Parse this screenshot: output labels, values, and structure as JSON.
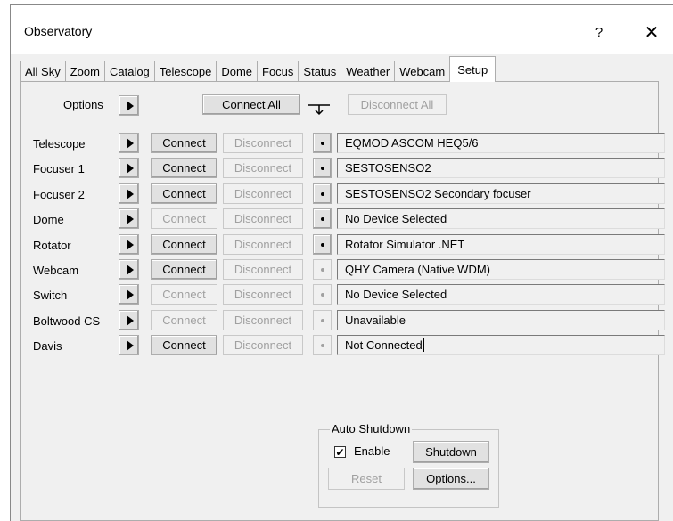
{
  "window": {
    "title": "Observatory",
    "help": "?",
    "close": "✕"
  },
  "tabs": [
    "All Sky",
    "Zoom",
    "Catalog",
    "Telescope",
    "Dome",
    "Focus",
    "Status",
    "Weather",
    "Webcam",
    "Setup"
  ],
  "active_tab": "Setup",
  "options_label": "Options",
  "connect_all": "Connect All",
  "disconnect_all": "Disconnect All",
  "connect_label": "Connect",
  "disconnect_label": "Disconnect",
  "devices": [
    {
      "label": "Telescope",
      "connect_enabled": true,
      "dot_enabled": true,
      "value": "EQMOD ASCOM HEQ5/6"
    },
    {
      "label": "Focuser 1",
      "connect_enabled": true,
      "dot_enabled": true,
      "value": "SESTOSENSO2"
    },
    {
      "label": "Focuser 2",
      "connect_enabled": true,
      "dot_enabled": true,
      "value": "SESTOSENSO2 Secondary focuser"
    },
    {
      "label": "Dome",
      "connect_enabled": false,
      "dot_enabled": true,
      "value": "No Device Selected"
    },
    {
      "label": "Rotator",
      "connect_enabled": true,
      "dot_enabled": true,
      "value": "Rotator Simulator .NET"
    },
    {
      "label": "Webcam",
      "connect_enabled": true,
      "dot_enabled": false,
      "value": "QHY Camera (Native WDM)"
    },
    {
      "label": "Switch",
      "connect_enabled": false,
      "dot_enabled": false,
      "value": "No Device Selected"
    },
    {
      "label": "Boltwood CS",
      "connect_enabled": false,
      "dot_enabled": false,
      "value": "Unavailable"
    },
    {
      "label": "Davis",
      "connect_enabled": true,
      "dot_enabled": false,
      "value": "Not Connected"
    }
  ],
  "auto_shutdown": {
    "title": "Auto Shutdown",
    "enable_label": "Enable",
    "enable_checked": true,
    "check_mark": "✔",
    "shutdown": "Shutdown",
    "reset": "Reset",
    "options": "Options..."
  }
}
